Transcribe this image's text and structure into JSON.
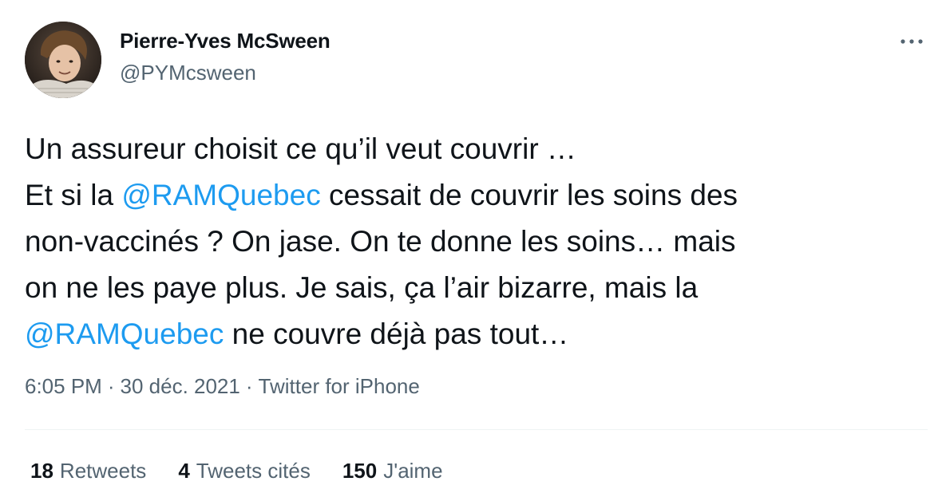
{
  "author": {
    "name": "Pierre-Yves McSween",
    "handle": "@PYMcsween",
    "avatar_icon": "profile-photo"
  },
  "more_icon": "more-horizontal-icon",
  "tweet": {
    "line1": "Un assureur choisit ce qu’il veut couvrir …",
    "line2_before": "Et si la ",
    "line2_mention": "@RAMQuebec",
    "line2_after": " cessait de couvrir les soins des",
    "line3": "non-vaccinés ?  On jase. On te donne les soins… mais",
    "line4": "on ne les paye plus. Je sais, ça l’air bizarre, mais la",
    "line5_mention": "@RAMQuebec",
    "line5_after": " ne couvre déjà pas tout…"
  },
  "meta": {
    "time": "6:05 PM",
    "separator": "·",
    "date": "30 déc. 2021",
    "source": "Twitter for iPhone"
  },
  "stats": [
    {
      "count": "18",
      "label": "Retweets"
    },
    {
      "count": "4",
      "label": "Tweets cités"
    },
    {
      "count": "150",
      "label": "J'aime"
    }
  ],
  "colors": {
    "text": "#0f1419",
    "secondary": "#536471",
    "link": "#1d9bf0",
    "divider": "#eff3f4"
  }
}
